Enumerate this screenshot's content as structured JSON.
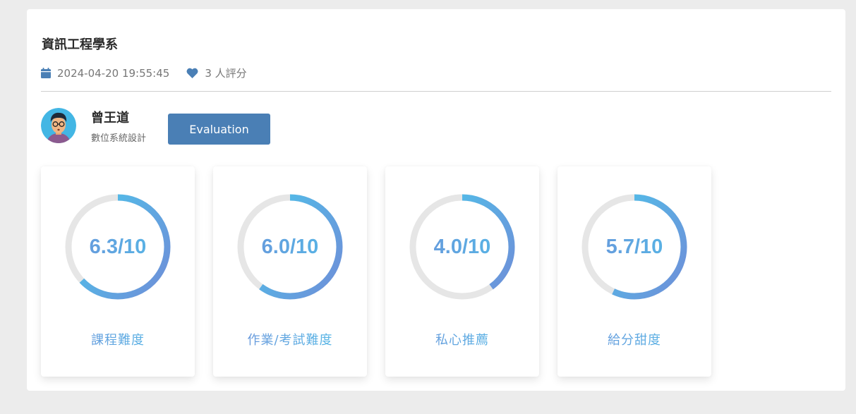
{
  "header": {
    "title": "資訊工程學系",
    "date_icon": "calendar-icon",
    "date": "2024-04-20 19:55:45",
    "rating_icon": "heart-icon",
    "rating_count": "3 人評分"
  },
  "professor": {
    "avatar": "avatar-man-glasses",
    "name": "曾王道",
    "course": "數位系統設計",
    "evaluation_label": "Evaluation"
  },
  "colors": {
    "accent": "#4a7fb5",
    "ring_start": "#6f8ed8",
    "ring_end": "#4fc1ea",
    "ring_track": "#e6e6e6"
  },
  "scores": [
    {
      "value": 6.3,
      "text": "6.3/10",
      "label": "課程難度"
    },
    {
      "value": 6.0,
      "text": "6.0/10",
      "label": "作業/考試難度"
    },
    {
      "value": 4.0,
      "text": "4.0/10",
      "label": "私心推薦"
    },
    {
      "value": 5.7,
      "text": "5.7/10",
      "label": "給分甜度"
    }
  ]
}
